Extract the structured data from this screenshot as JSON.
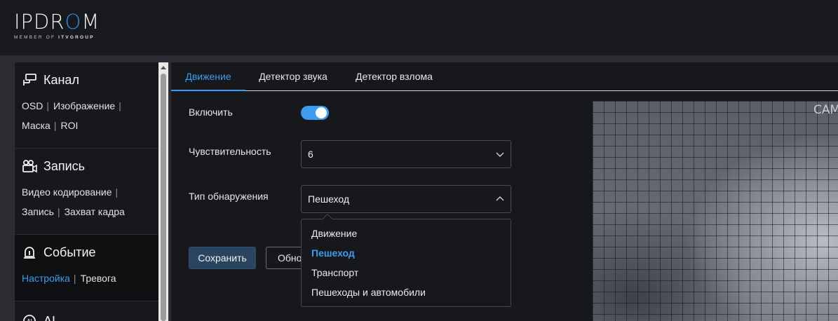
{
  "brand": {
    "logo_ip": "IP",
    "logo_dr": "DR",
    "logo_o": "O",
    "logo_m": "M",
    "sub_prefix": "MEMBER OF ",
    "sub_group": "ITVGROUP"
  },
  "sidebar": {
    "channel": {
      "title": "Канал",
      "links": [
        "OSD",
        "Изображение",
        "Маска",
        "ROI"
      ]
    },
    "record": {
      "title": "Запись",
      "links": [
        "Видео кодирование",
        "Запись",
        "Захват кадра"
      ]
    },
    "event": {
      "title": "Событие",
      "links": [
        "Настройка",
        "Тревога"
      ]
    },
    "ai": {
      "title": "AI"
    }
  },
  "tabs": [
    "Движение",
    "Детектор звука",
    "Детектор взлома"
  ],
  "form": {
    "enable_label": "Включить",
    "enable_value": true,
    "sensitivity_label": "Чувствительность",
    "sensitivity_value": "6",
    "detection_type_label": "Тип обнаружения",
    "detection_type_value": "Пешеход",
    "detection_options": [
      "Движение",
      "Пешеход",
      "Транспорт",
      "Пешеходы и автомобили"
    ],
    "save_label": "Сохранить",
    "refresh_label": "Обновить"
  },
  "preview": {
    "label": "CAM"
  },
  "colors": {
    "accent": "#3d9cf0",
    "background": "#17181b"
  }
}
